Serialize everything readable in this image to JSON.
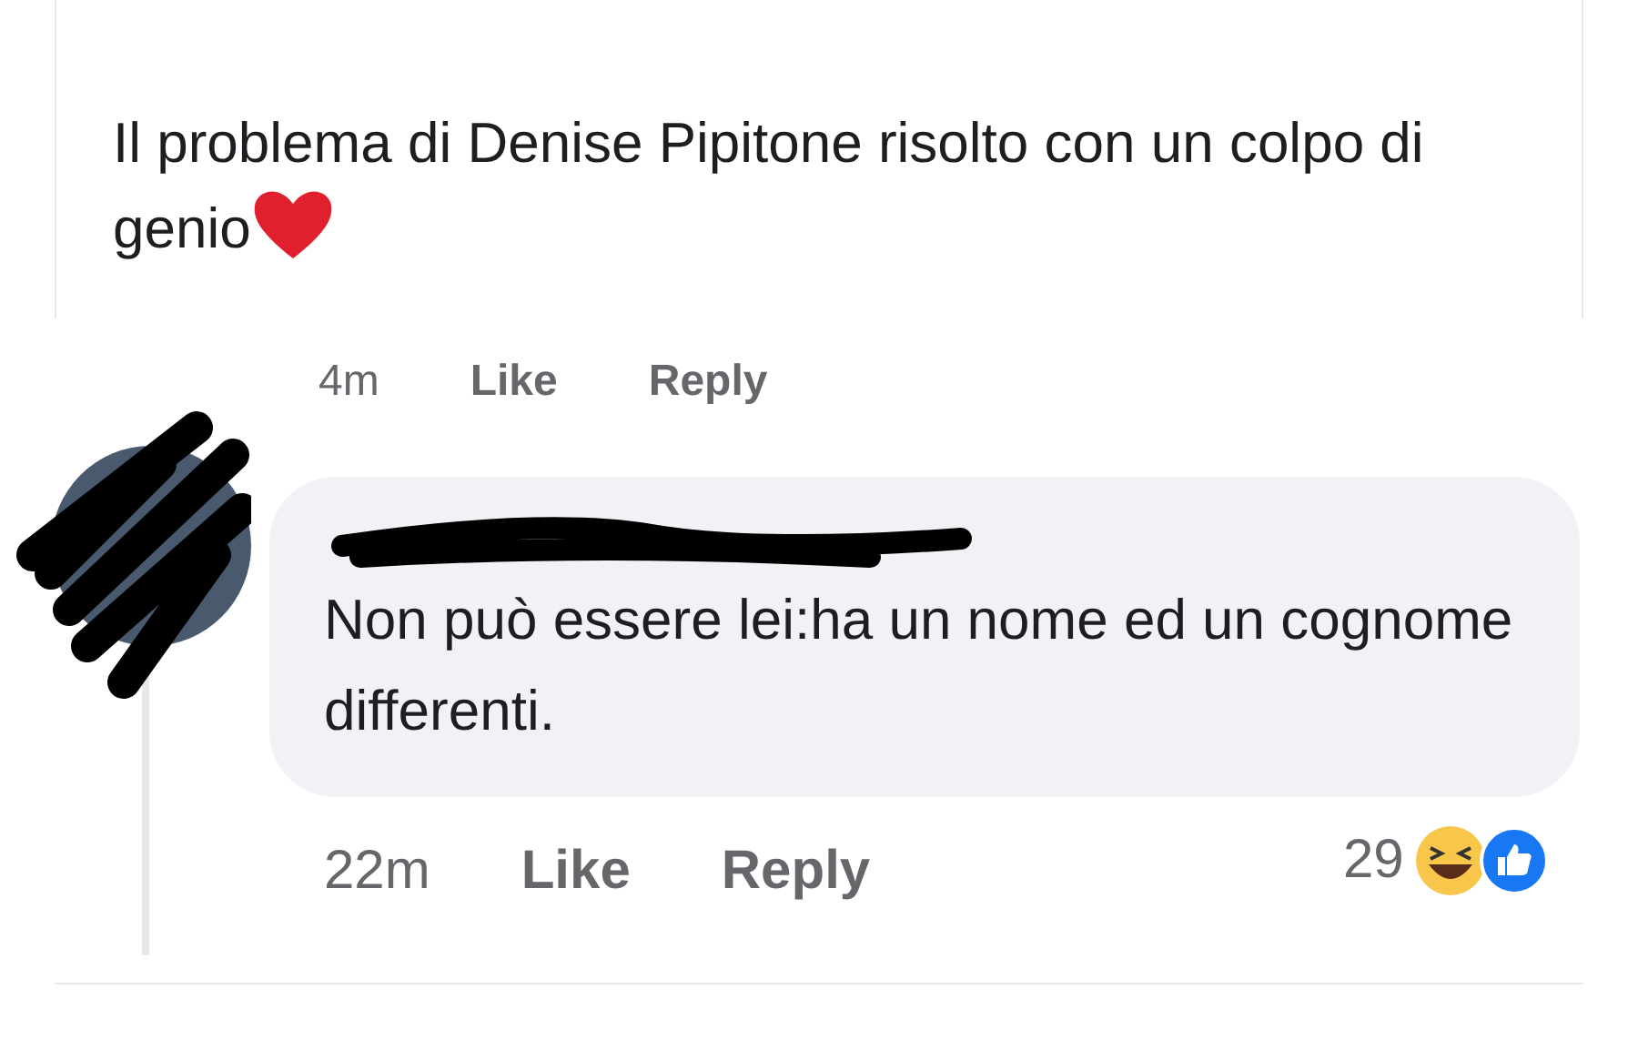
{
  "post": {
    "text": "Il problema di Denise Pipitone risolto con un colpo di genio",
    "actions": [
      {
        "kind": "time",
        "label": "4m"
      },
      {
        "kind": "link",
        "label": "Like"
      },
      {
        "kind": "link",
        "label": "Reply"
      }
    ]
  },
  "comment": {
    "text": "Non può essere lei:ha un nome ed un cognome differenti.",
    "actions": [
      {
        "kind": "time",
        "label": "22m"
      },
      {
        "kind": "link",
        "label": "Like"
      },
      {
        "kind": "link",
        "label": "Reply"
      }
    ],
    "reaction_count": "29"
  }
}
